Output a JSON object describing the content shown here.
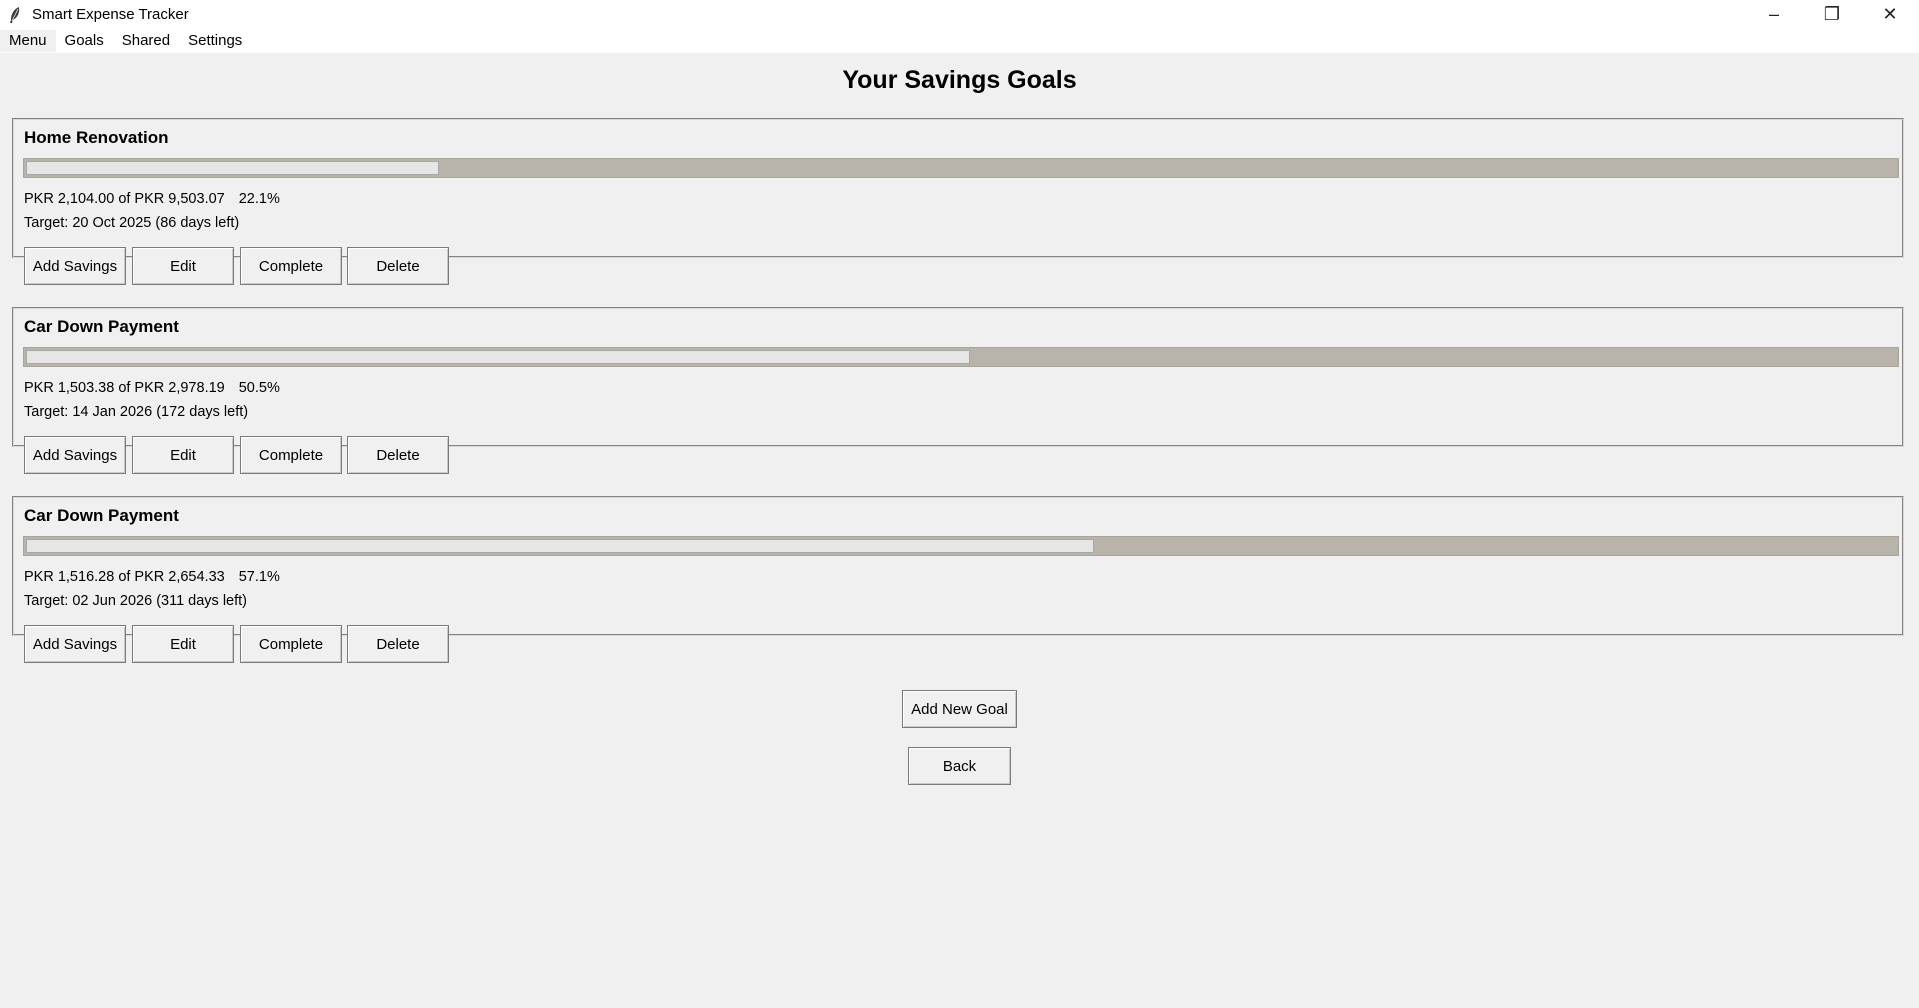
{
  "window": {
    "title": "Smart Expense Tracker",
    "controls": {
      "minimize": "–",
      "restore": "❐",
      "close": "✕"
    }
  },
  "menubar": {
    "items": [
      "Menu",
      "Goals",
      "Shared",
      "Settings"
    ]
  },
  "page": {
    "title": "Your Savings Goals"
  },
  "goals": [
    {
      "name": "Home Renovation",
      "amount_text": "PKR 2,104.00 of PKR 9,503.07",
      "percent_text": "22.1%",
      "progress_fraction": 0.221,
      "target_text": "Target: 20 Oct 2025 (86 days left)"
    },
    {
      "name": "Car Down Payment",
      "amount_text": "PKR 1,503.38 of PKR 2,978.19",
      "percent_text": "50.5%",
      "progress_fraction": 0.505,
      "target_text": "Target: 14 Jan 2026 (172 days left)"
    },
    {
      "name": "Car Down Payment",
      "amount_text": "PKR 1,516.28 of PKR 2,654.33",
      "percent_text": "57.1%",
      "progress_fraction": 0.571,
      "target_text": "Target: 02 Jun 2026 (311 days left)"
    }
  ],
  "goal_actions": {
    "add_savings": "Add Savings",
    "edit": "Edit",
    "complete": "Complete",
    "delete": "Delete"
  },
  "footer": {
    "add_new_goal": "Add New Goal",
    "back": "Back"
  },
  "colors": {
    "progress_trough": "#b8b4aa",
    "progress_fill": "#e6e6e6",
    "background": "#f0f0f0"
  }
}
